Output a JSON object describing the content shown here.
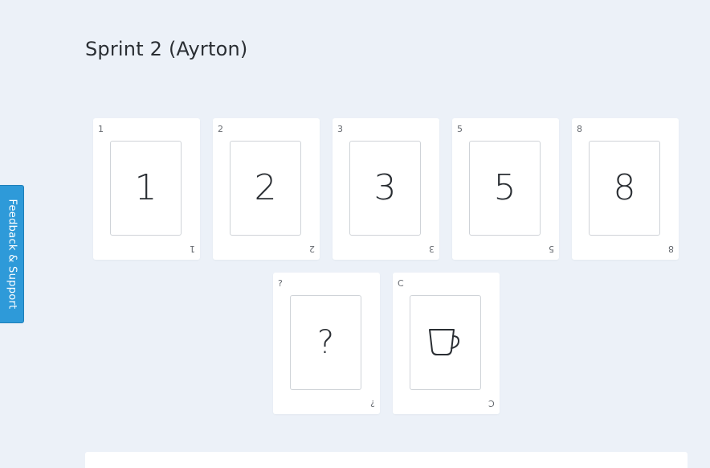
{
  "page": {
    "title": "Sprint 2 (Ayrton)"
  },
  "feedback": {
    "label": "Feedback & Support"
  },
  "cards": [
    {
      "value": "1",
      "corner": "1"
    },
    {
      "value": "2",
      "corner": "2"
    },
    {
      "value": "3",
      "corner": "3"
    },
    {
      "value": "5",
      "corner": "5"
    },
    {
      "value": "8",
      "corner": "8"
    },
    {
      "value": "?",
      "corner": "?"
    },
    {
      "value": "coffee",
      "corner": "C",
      "icon": "coffee-cup-icon"
    }
  ],
  "colors": {
    "background": "#ecf1f8",
    "feedback_tab": "#2e9ad9",
    "card": "#ffffff"
  }
}
